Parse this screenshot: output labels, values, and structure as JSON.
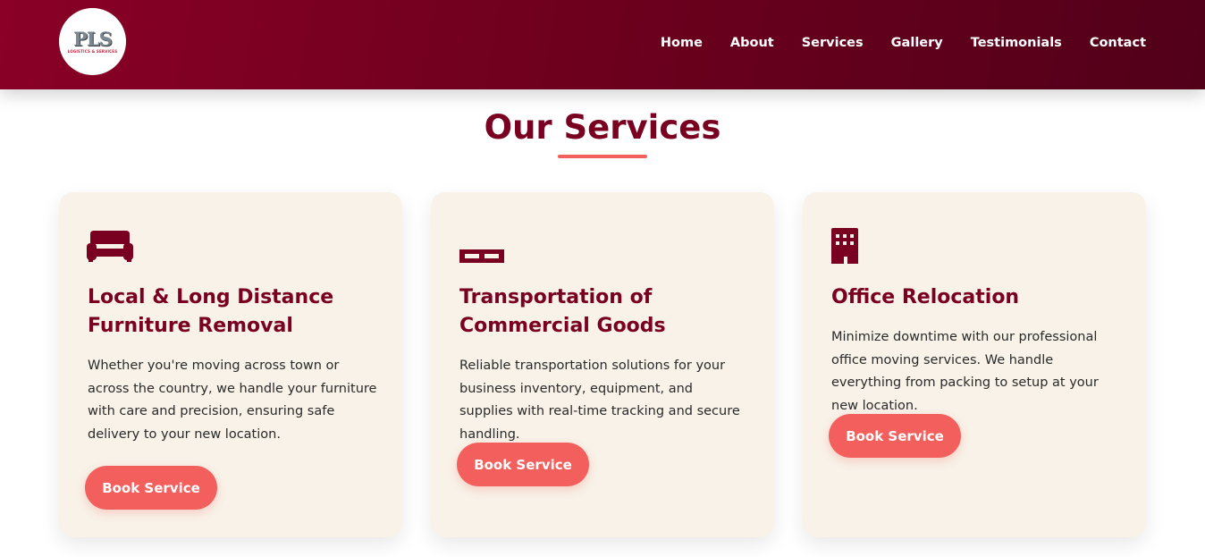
{
  "header": {
    "logo": {
      "text": "PLS",
      "subtext": "LOGISTICS & SERVICES"
    },
    "nav": [
      {
        "label": "Home"
      },
      {
        "label": "About"
      },
      {
        "label": "Services"
      },
      {
        "label": "Gallery"
      },
      {
        "label": "Testimonials"
      },
      {
        "label": "Contact"
      }
    ]
  },
  "main": {
    "title": "Our Services",
    "cards": [
      {
        "icon": "couch-icon",
        "title_lines": [
          "Local & Long Distance",
          "Furniture Removal"
        ],
        "description": "Whether you're moving across town or across the country, we handle your furniture with care and precision, ensuring safe delivery to your new location.",
        "button": "Book Service"
      },
      {
        "icon": "pallet-icon",
        "title_lines": [
          "Transportation of",
          "Commercial Goods"
        ],
        "description": "Reliable transportation solutions for your business inventory, equipment, and supplies with real-time tracking and secure handling.",
        "button": "Book Service"
      },
      {
        "icon": "building-icon",
        "title_lines": [
          "Office Relocation"
        ],
        "description": "Minimize downtime with our professional office moving services. We handle everything from packing to setup at your new location.",
        "button": "Book Service"
      }
    ]
  },
  "colors": {
    "header_start": "#8a0026",
    "header_end": "#52001a",
    "brand": "#7a0022",
    "accent": "#f25f5c",
    "card_bg": "#f8f2e8"
  }
}
